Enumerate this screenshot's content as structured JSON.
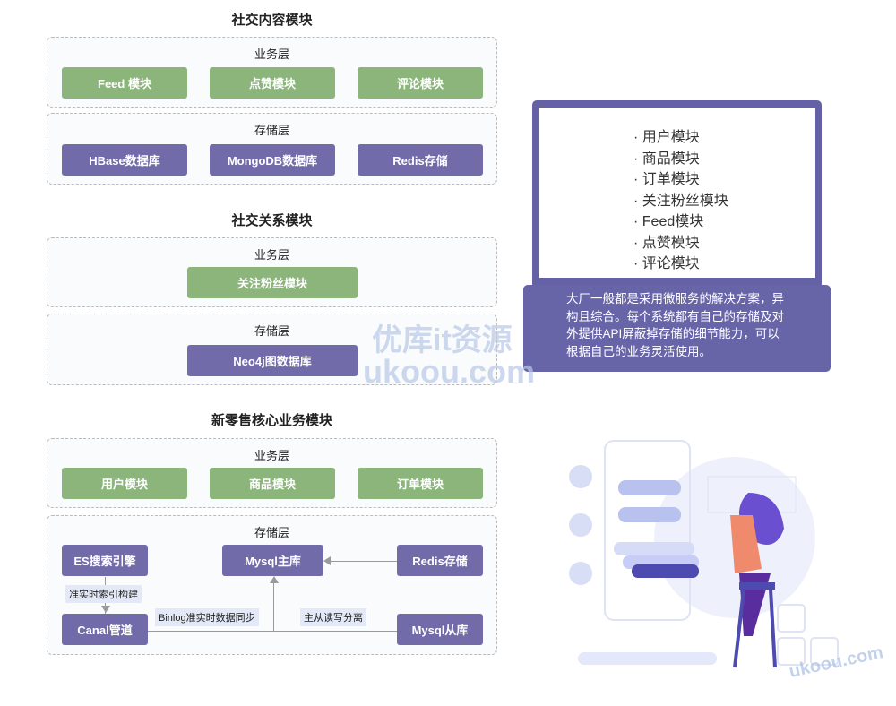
{
  "sections": [
    {
      "title": "社交内容模块",
      "business_label": "业务层",
      "business": [
        "Feed 模块",
        "点赞模块",
        "评论模块"
      ],
      "storage_label": "存储层",
      "storage": [
        "HBase数据库",
        "MongoDB数据库",
        "Redis存储"
      ]
    },
    {
      "title": "社交关系模块",
      "business_label": "业务层",
      "business": [
        "关注粉丝模块"
      ],
      "storage_label": "存储层",
      "storage": [
        "Neo4j图数据库"
      ]
    },
    {
      "title": "新零售核心业务模块",
      "business_label": "业务层",
      "business": [
        "用户模块",
        "商品模块",
        "订单模块"
      ],
      "storage_label": "存储层",
      "storage": {
        "es": "ES搜索引擎",
        "mysql_master": "Mysql主库",
        "redis": "Redis存储",
        "canal": "Canal管道",
        "mysql_slave": "Mysql从库"
      },
      "edge_labels": {
        "index": "准实时索引构建",
        "binlog": "Binlog准实时数据同步",
        "rw": "主从读写分离"
      }
    }
  ],
  "laptop": {
    "list": [
      "用户模块",
      "商品模块",
      "订单模块",
      "关注粉丝模块",
      "Feed模块",
      "点赞模块",
      "评论模块"
    ],
    "description": "大厂一般都是采用微服务的解决方案，异构且综合。每个系统都有自己的存储及对外提供API屏蔽掉存储的细节能力，可以根据自己的业务灵活使用。"
  },
  "watermark": {
    "line1": "优库it资源",
    "line2": "ukoou.com",
    "corner": "ukoou.com"
  },
  "colors": {
    "green": "#8bb57b",
    "purple": "#716ca9",
    "laptop": "#6461a6"
  }
}
